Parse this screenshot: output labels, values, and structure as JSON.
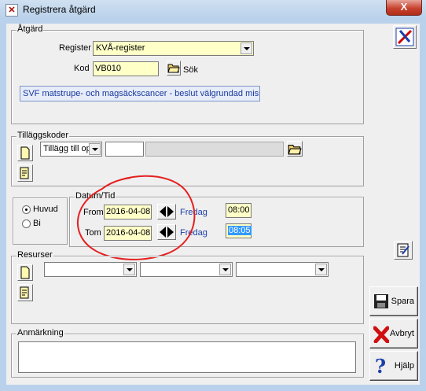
{
  "window": {
    "title": "Registrera åtgärd",
    "close_label": "X"
  },
  "atgard": {
    "group_label": "Åtgärd",
    "register_label": "Register",
    "register_value": "KVÅ-register",
    "kod_label": "Kod",
    "kod_value": "VB010",
    "sok_label": "Sök",
    "description": "SVF matstrupe- och magsäckscancer - beslut välgrundad misst"
  },
  "tillaggskoder": {
    "group_label": "Tilläggskoder",
    "type_value": "Tillägg till op",
    "code_value": "",
    "text_value": ""
  },
  "period": {
    "huvud_label": "Huvud",
    "bi_label": "Bi",
    "selected": "Huvud"
  },
  "datum_tid": {
    "group_label": "Datum/Tid",
    "from_label": "From",
    "from_date": "2016-04-08",
    "from_day": "Fredag",
    "from_time": "08:00",
    "tom_label": "Tom",
    "tom_date": "2016-04-08",
    "tom_day": "Fredag",
    "tom_time": "08:05"
  },
  "resurser": {
    "group_label": "Resurser"
  },
  "anmarkning": {
    "group_label": "Anmärkning",
    "value": ""
  },
  "buttons": {
    "spara": "Spara",
    "avbryt": "Avbryt",
    "hjalp": "Hjälp"
  },
  "colors": {
    "highlight": "#3399ff",
    "annotation": "#e52020",
    "yellow_field": "#ffffc8"
  }
}
